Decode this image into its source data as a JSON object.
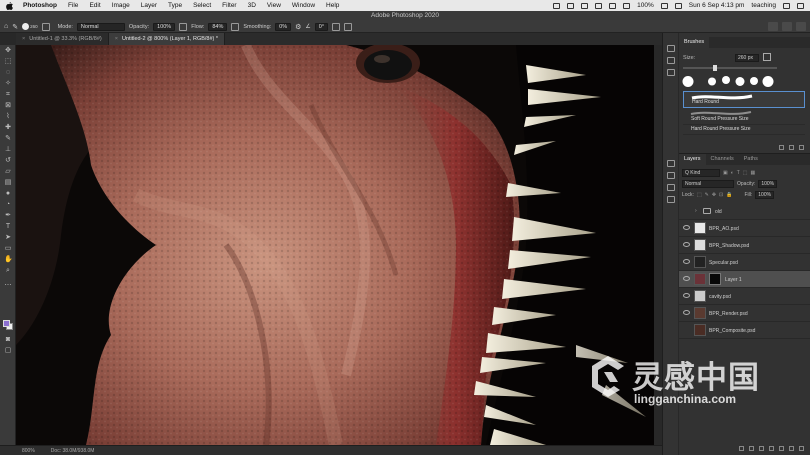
{
  "menubar": {
    "app": "Photoshop",
    "items": [
      "File",
      "Edit",
      "Image",
      "Layer",
      "Type",
      "Select",
      "Filter",
      "3D",
      "View",
      "Window",
      "Help"
    ],
    "battery": "100%",
    "datetime": "Sun 6 Sep 4:13 pm",
    "user": "teaching"
  },
  "app_title": "Adobe Photoshop 2020",
  "options": {
    "brush_size": "260",
    "mode_label": "Mode:",
    "mode_value": "Normal",
    "opacity_label": "Opacity:",
    "opacity_value": "100%",
    "flow_label": "Flow:",
    "flow_value": "84%",
    "smoothing_label": "Smoothing:",
    "smoothing_value": "0%",
    "angle_value": "0°"
  },
  "tabs": [
    {
      "label": "Untitled-1 @ 33.3% (RGB/8#)",
      "active": false
    },
    {
      "label": "Untitled-2 @ 800% (Layer 1, RGB/8#) *",
      "active": true
    }
  ],
  "status": {
    "zoom": "800%",
    "doc": "Doc: 38.0M/938.0M"
  },
  "brushes_panel": {
    "tab": "Brushes",
    "size_label": "Size:",
    "size_value": "260 px",
    "presets": [
      "Hard Round",
      "Soft Round Pressure Size",
      "Hard Round Pressure Size"
    ]
  },
  "layers_panel": {
    "tabs": [
      "Layers",
      "Channels",
      "Paths"
    ],
    "filter_label": "Q Kind",
    "blend_mode": "Normal",
    "opacity_label": "Opacity:",
    "opacity_value": "100%",
    "lock_label": "Lock:",
    "fill_label": "Fill:",
    "fill_value": "100%",
    "layers": [
      {
        "name": "old",
        "type": "group",
        "visible": false
      },
      {
        "name": "BPR_AO.psd",
        "type": "layer",
        "visible": true
      },
      {
        "name": "BPR_Shadow.psd",
        "type": "layer",
        "visible": true
      },
      {
        "name": "Specular.psd",
        "type": "layer",
        "visible": true
      },
      {
        "name": "Layer 1",
        "type": "masked",
        "visible": true,
        "selected": true
      },
      {
        "name": "cavity.psd",
        "type": "layer",
        "visible": true
      },
      {
        "name": "BPR_Render.psd",
        "type": "layer",
        "visible": true
      },
      {
        "name": "BPR_Composite.psd",
        "type": "layer",
        "visible": false
      }
    ]
  },
  "colors": {
    "foreground": "#8b6fd0",
    "background": "#f0f0f0",
    "selection_accent": "#5a90d0"
  },
  "watermark": {
    "chinese": "灵感中国",
    "site": "lingganchina.com"
  }
}
